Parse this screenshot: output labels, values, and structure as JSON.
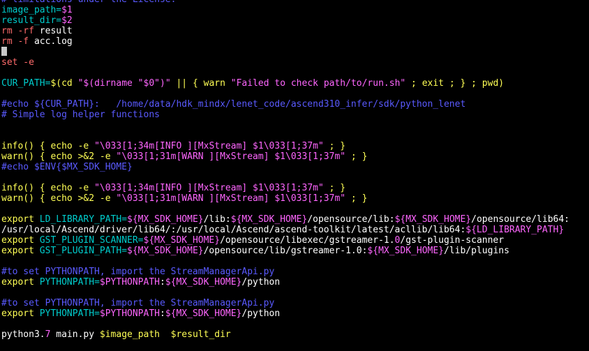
{
  "colors": {
    "default": "#ffffff",
    "comment": "#5a5aff",
    "keyword": "#ff6b6b",
    "command": "#ffff55",
    "string": "#ff66ff",
    "var": "#00cdcd",
    "variable": "#ff66ff"
  },
  "lines": [
    [
      {
        "t": "# limitations under the License.",
        "c": "comment"
      }
    ],
    [
      {
        "t": "image_path=",
        "c": "var"
      },
      {
        "t": "$1",
        "c": "variable"
      }
    ],
    [
      {
        "t": "result_dir=",
        "c": "var"
      },
      {
        "t": "$2",
        "c": "variable"
      }
    ],
    [
      {
        "t": "rm ",
        "c": "keyword"
      },
      {
        "t": "-rf",
        "c": "keyword"
      },
      {
        "t": " result",
        "c": "default"
      }
    ],
    [
      {
        "t": "rm ",
        "c": "keyword"
      },
      {
        "t": "-f",
        "c": "keyword"
      },
      {
        "t": " acc.log",
        "c": "default"
      }
    ],
    "cursor",
    [
      {
        "t": "set -e",
        "c": "keyword"
      }
    ],
    [],
    [
      {
        "t": "CUR_PATH=",
        "c": "var"
      },
      {
        "t": "$(cd ",
        "c": "command"
      },
      {
        "t": "\"$(dirname \"$0\")\"",
        "c": "string"
      },
      {
        "t": " || { ",
        "c": "command"
      },
      {
        "t": "warn ",
        "c": "command"
      },
      {
        "t": "\"Failed to check path/to/run.sh\"",
        "c": "string"
      },
      {
        "t": " ; exit ; } ; pwd)",
        "c": "command"
      }
    ],
    [],
    [
      {
        "t": "#echo ${CUR_PATH}:   /home/data/hdk_mindx/lenet_code/ascend310_infer/sdk/python_lenet",
        "c": "comment"
      }
    ],
    [
      {
        "t": "# Simple log helper functions",
        "c": "comment"
      }
    ],
    [],
    [],
    [
      {
        "t": "info() { ",
        "c": "command"
      },
      {
        "t": "echo -e ",
        "c": "command"
      },
      {
        "t": "\"\\033[1;34m[INFO ][MxStream] $1\\033[1;37m\"",
        "c": "string"
      },
      {
        "t": " ; }",
        "c": "command"
      }
    ],
    [
      {
        "t": "warn() { ",
        "c": "command"
      },
      {
        "t": "echo >&2 -e ",
        "c": "command"
      },
      {
        "t": "\"\\033[1;31m[WARN ][MxStream] $1\\033[1;37m\"",
        "c": "string"
      },
      {
        "t": " ; }",
        "c": "command"
      }
    ],
    [
      {
        "t": "#echo $ENV{$MX_SDK_HOME}",
        "c": "comment"
      }
    ],
    [],
    [
      {
        "t": "info() { ",
        "c": "command"
      },
      {
        "t": "echo -e ",
        "c": "command"
      },
      {
        "t": "\"\\033[1;34m[INFO ][MxStream] $1\\033[1;37m\"",
        "c": "string"
      },
      {
        "t": " ; }",
        "c": "command"
      }
    ],
    [
      {
        "t": "warn() { ",
        "c": "command"
      },
      {
        "t": "echo >&2 -e ",
        "c": "command"
      },
      {
        "t": "\"\\033[1;31m[WARN ][MxStream] $1\\033[1;37m\"",
        "c": "string"
      },
      {
        "t": " ; }",
        "c": "command"
      }
    ],
    [],
    [
      {
        "t": "export ",
        "c": "command"
      },
      {
        "t": "LD_LIBRARY_PATH=",
        "c": "var"
      },
      {
        "t": "${MX_SDK_HOME}",
        "c": "variable"
      },
      {
        "t": "/lib:",
        "c": "default"
      },
      {
        "t": "${MX_SDK_HOME}",
        "c": "variable"
      },
      {
        "t": "/opensource/lib:",
        "c": "default"
      },
      {
        "t": "${MX_SDK_HOME}",
        "c": "variable"
      },
      {
        "t": "/opensource/lib64:",
        "c": "default"
      }
    ],
    [
      {
        "t": "/usr/local/Ascend/driver/lib64/:/usr/local/Ascend/ascend-toolkit/latest/acllib/lib64:",
        "c": "default"
      },
      {
        "t": "${LD_LIBRARY_PATH}",
        "c": "variable"
      }
    ],
    [
      {
        "t": "export ",
        "c": "command"
      },
      {
        "t": "GST_PLUGIN_SCANNER=",
        "c": "var"
      },
      {
        "t": "${MX_SDK_HOME}",
        "c": "variable"
      },
      {
        "t": "/opensource/libexec/gstreamer-1.",
        "c": "default"
      },
      {
        "t": "0",
        "c": "variable"
      },
      {
        "t": "/gst-plugin-scanner",
        "c": "default"
      }
    ],
    [
      {
        "t": "export ",
        "c": "command"
      },
      {
        "t": "GST_PLUGIN_PATH=",
        "c": "var"
      },
      {
        "t": "${MX_SDK_HOME}",
        "c": "variable"
      },
      {
        "t": "/opensource/lib/gstreamer-1.0:",
        "c": "default"
      },
      {
        "t": "${MX_SDK_HOME}",
        "c": "variable"
      },
      {
        "t": "/lib/plugins",
        "c": "default"
      }
    ],
    [],
    [
      {
        "t": "#to set PYTHONPATH, import the StreamManagerApi.py",
        "c": "comment"
      }
    ],
    [
      {
        "t": "export ",
        "c": "command"
      },
      {
        "t": "PYTHONPATH=",
        "c": "var"
      },
      {
        "t": "$PYTHONPATH",
        "c": "variable"
      },
      {
        "t": ":",
        "c": "default"
      },
      {
        "t": "${MX_SDK_HOME}",
        "c": "variable"
      },
      {
        "t": "/python",
        "c": "default"
      }
    ],
    [],
    [
      {
        "t": "#to set PYTHONPATH, import the StreamManagerApi.py",
        "c": "comment"
      }
    ],
    [
      {
        "t": "export ",
        "c": "command"
      },
      {
        "t": "PYTHONPATH=",
        "c": "var"
      },
      {
        "t": "$PYTHONPATH",
        "c": "variable"
      },
      {
        "t": ":",
        "c": "default"
      },
      {
        "t": "${MX_SDK_HOME}",
        "c": "variable"
      },
      {
        "t": "/python",
        "c": "default"
      }
    ],
    [],
    [
      {
        "t": "python3.",
        "c": "default"
      },
      {
        "t": "7",
        "c": "variable"
      },
      {
        "t": " main.py ",
        "c": "default"
      },
      {
        "t": "$image_path",
        "c": "command"
      },
      {
        "t": "  ",
        "c": "default"
      },
      {
        "t": "$result_dir",
        "c": "command"
      }
    ]
  ]
}
